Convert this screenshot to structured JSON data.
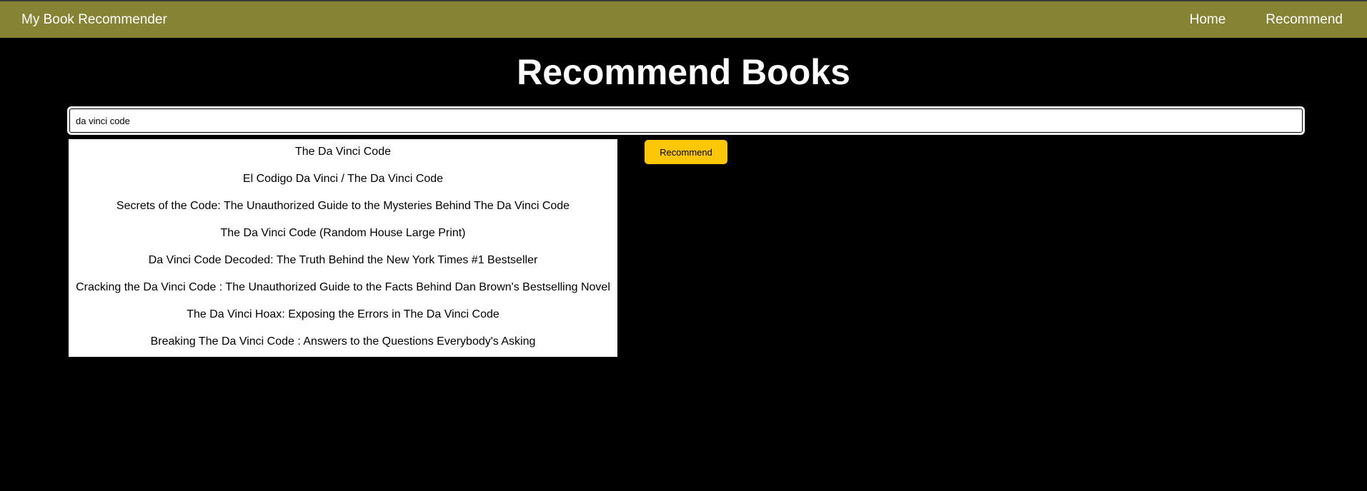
{
  "navbar": {
    "brand": "My Book Recommender",
    "links": [
      "Home",
      "Recommend"
    ],
    "background": "#868434"
  },
  "main": {
    "title": "Recommend Books",
    "search": {
      "value": "da vinci code ",
      "placeholder": ""
    },
    "suggestions": [
      "The Da Vinci Code",
      "El Codigo Da Vinci / The Da Vinci Code",
      "Secrets of the Code: The Unauthorized Guide to the Mysteries Behind The Da Vinci Code",
      "The Da Vinci Code (Random House Large Print)",
      "Da Vinci Code Decoded: The Truth Behind the New York Times #1 Bestseller",
      "Cracking the Da Vinci Code : The Unauthorized Guide to the Facts Behind Dan Brown's Bestselling Novel",
      "The Da Vinci Hoax: Exposing the Errors in The Da Vinci Code",
      "Breaking The Da Vinci Code : Answers to the Questions Everybody's Asking"
    ],
    "recommend_button": "Recommend",
    "accent": "#fbc707"
  }
}
